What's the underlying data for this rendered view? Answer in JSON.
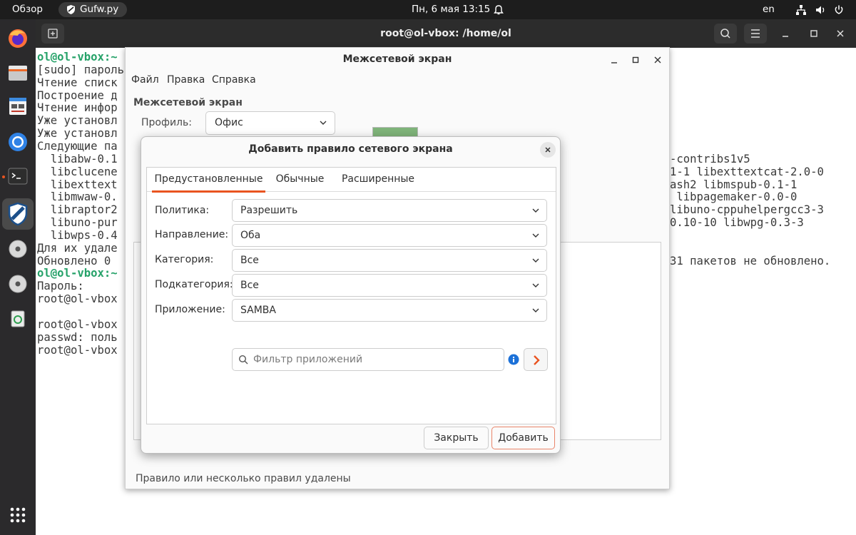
{
  "topbar": {
    "overview": "Обзор",
    "app_name": "Gufw.py",
    "datetime": "Пн, 6 мая  13:15",
    "lang": "en"
  },
  "terminal": {
    "title": "root@ol-vbox: /home/ol",
    "left_lines": [
      {
        "prompt": "ol@ol-vbox:~",
        "text": ""
      },
      {
        "prompt": "",
        "text": "[sudo] пароль"
      },
      {
        "prompt": "",
        "text": "Чтение списк"
      },
      {
        "prompt": "",
        "text": "Построение д"
      },
      {
        "prompt": "",
        "text": "Чтение инфор"
      },
      {
        "prompt": "",
        "text": "Уже установл"
      },
      {
        "prompt": "",
        "text": "Уже установл"
      },
      {
        "prompt": "",
        "text": "Следующие па"
      },
      {
        "prompt": "",
        "text": "  libabw-0.1"
      },
      {
        "prompt": "",
        "text": "  libclucene"
      },
      {
        "prompt": "",
        "text": "  libexttext"
      },
      {
        "prompt": "",
        "text": "  libmwaw-0."
      },
      {
        "prompt": "",
        "text": "  libraptor2"
      },
      {
        "prompt": "",
        "text": "  libuno-pur"
      },
      {
        "prompt": "",
        "text": "  libwps-0.4"
      },
      {
        "prompt": "",
        "text": "Для их удале"
      },
      {
        "prompt": "",
        "text": "Обновлено 0"
      },
      {
        "prompt": "ol@ol-vbox:~",
        "text": ""
      },
      {
        "prompt": "",
        "text": "Пароль:"
      },
      {
        "prompt": "",
        "text": "root@ol-vbox"
      },
      {
        "prompt": "",
        "text": ""
      },
      {
        "prompt": "",
        "text": "root@ol-vbox"
      },
      {
        "prompt": "",
        "text": "passwd: поль"
      },
      {
        "prompt": "",
        "text": "root@ol-vbox"
      }
    ],
    "right_lines": [
      {
        "row": 8,
        "text": "-contribs1v5"
      },
      {
        "row": 9,
        "text": "1-1 libexttextcat-2.0-0"
      },
      {
        "row": 10,
        "text": "ash2 libmspub-0.1-1"
      },
      {
        "row": 11,
        "text": " libpagemaker-0.0-0"
      },
      {
        "row": 12,
        "text": "libuno-cppuhelpergcc3-3"
      },
      {
        "row": 13,
        "text": "0.10-10 libwpg-0.3-3"
      },
      {
        "row": 16,
        "text": "31 пакетов не обновлено."
      }
    ]
  },
  "gufw": {
    "title": "Межсетевой экран",
    "menu": [
      "Файл",
      "Правка",
      "Справка"
    ],
    "heading": "Межсетевой экран",
    "profile_label": "Профиль:",
    "profile_value": "Офис",
    "status": "Правило или несколько правил удалены"
  },
  "dialog": {
    "title": "Добавить правило сетевого экрана",
    "tabs": [
      "Предустановленные",
      "Обычные",
      "Расширенные"
    ],
    "active_tab": "Предустановленные",
    "fields": [
      {
        "label": "Политика:",
        "value": "Разрешить"
      },
      {
        "label": "Направление:",
        "value": "Оба"
      },
      {
        "label": "Категория:",
        "value": "Все"
      },
      {
        "label": "Подкатегория:",
        "value": "Все"
      },
      {
        "label": "Приложение:",
        "value": "SAMBA"
      }
    ],
    "filter_placeholder": "Фильтр приложений",
    "close_button": "Закрыть",
    "add_button": "Добавить"
  },
  "icons": {
    "dock": [
      "firefox-icon",
      "files-icon",
      "text-editor-icon",
      "chromium-icon",
      "terminal-icon",
      "gufw-icon",
      "disc-icon",
      "disc-icon",
      "trash-icon",
      "app-grid-icon"
    ],
    "tray": [
      "network-icon",
      "volume-icon",
      "power-icon"
    ]
  },
  "colors": {
    "accent": "#e95420",
    "prompt": "#26a269",
    "topbar_bg": "#1d1d1d",
    "dock_bg": "#2b2a2c",
    "info_blue": "#1c71d8"
  }
}
